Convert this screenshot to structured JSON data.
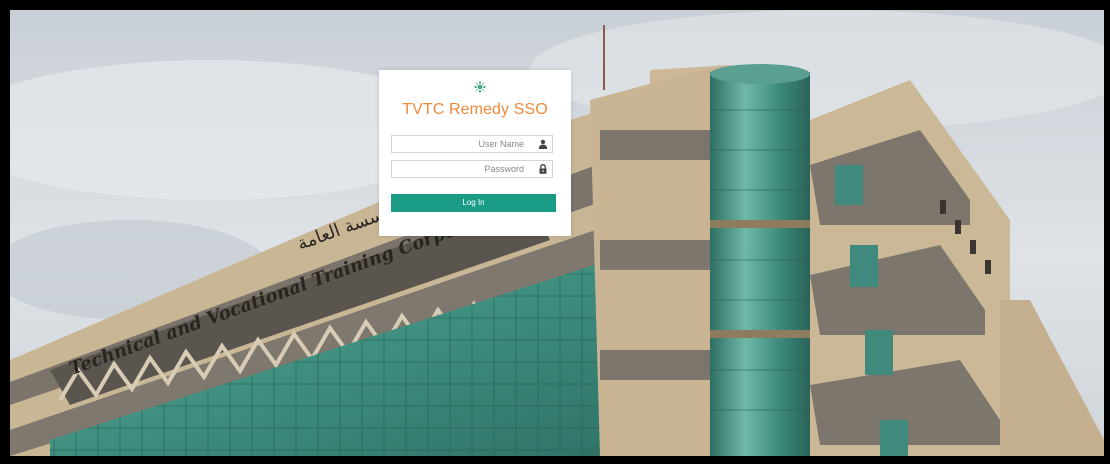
{
  "login": {
    "title": "TVTC Remedy SSO",
    "username_placeholder": "User Name",
    "password_placeholder": "Password",
    "login_button": "Log In",
    "username_icon": "user-icon",
    "password_icon": "lock-icon",
    "logo": "tvtc-logo"
  },
  "background": {
    "sign_text": "Technical and Vocational Training Corporation",
    "sign_text_arabic": "المؤسسة العامة للتدريب التقني والمهني"
  },
  "colors": {
    "title": "#f08a3c",
    "button": "#1a9b86",
    "glass": "#4f9a8e",
    "stone": "#c8b594",
    "band": "#7d776f"
  }
}
